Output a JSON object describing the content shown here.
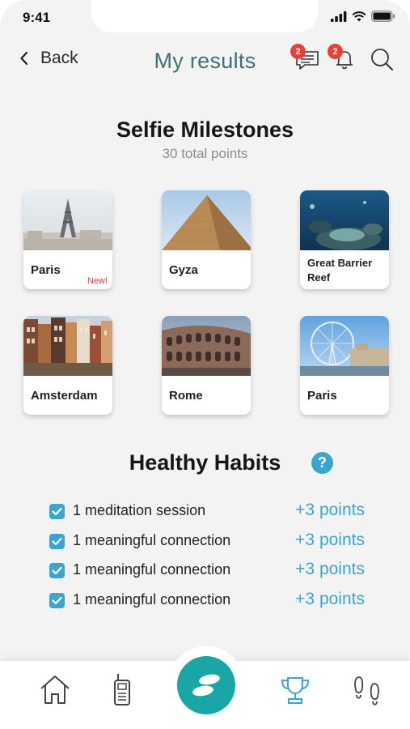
{
  "status_bar": {
    "time": "9:41",
    "icons": [
      "cellular-signal-icon",
      "wifi-icon",
      "battery-icon"
    ]
  },
  "header": {
    "back_label": "Back",
    "title": "My results",
    "messages_badge": "2",
    "notifications_badge": "2",
    "icons": [
      "chevron-left-icon",
      "chat-icon",
      "bell-icon",
      "search-icon"
    ]
  },
  "selfie_milestones": {
    "title": "Selfie Milestones",
    "subtitle": "30 total points",
    "cards": [
      {
        "label": "Paris",
        "badge": "New!",
        "image": "eiffel-tower-photo"
      },
      {
        "label": "Gyza",
        "image": "pyramid-photo"
      },
      {
        "label": "Great Barrier Reef",
        "image": "coral-reef-photo"
      },
      {
        "label": "Amsterdam",
        "image": "canal-houses-photo"
      },
      {
        "label": "Rome",
        "image": "colosseum-photo"
      },
      {
        "label": "Paris",
        "image": "ferris-wheel-photo"
      }
    ]
  },
  "healthy_habits": {
    "title": "Healthy Habits",
    "help_icon": "?",
    "items": [
      {
        "label": "1 meditation session",
        "points": "+3 points",
        "checked": true
      },
      {
        "label": "1 meaningful connection",
        "points": "+3 points",
        "checked": true
      },
      {
        "label": "1 meaningful connection",
        "points": "+3 points",
        "checked": true
      },
      {
        "label": "1 meaningful connection",
        "points": "+3 points",
        "checked": true
      }
    ]
  },
  "bottom_nav": {
    "items": [
      "home-icon",
      "walkie-talkie-icon",
      "footprint-logo-icon",
      "trophy-icon",
      "footsteps-icon"
    ],
    "active": "trophy-icon"
  },
  "colors": {
    "accent": "#3aa6d0",
    "title_teal": "#3e7273",
    "nav_center": "#18a6a7",
    "badge_red": "#e8403a",
    "new_red": "#e13b3b",
    "background": "#f3f3f3"
  }
}
